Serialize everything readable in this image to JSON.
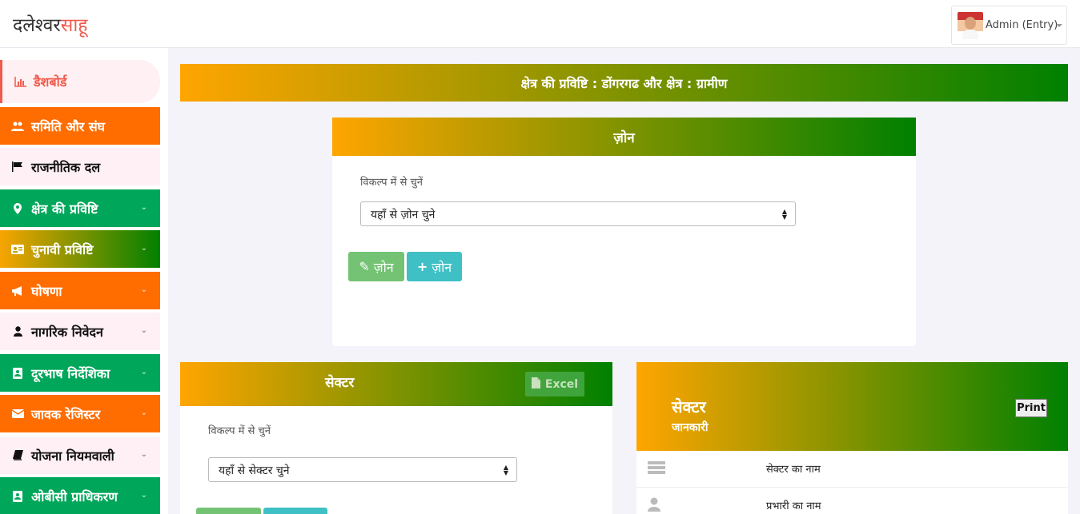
{
  "header": {
    "logo_main": "दलेश्वर",
    "logo_accent": "साहू",
    "user_label": "Admin (Entry)"
  },
  "sidebar": {
    "items": [
      {
        "label": "डैशबोर्ड",
        "icon": "bar-chart-icon"
      },
      {
        "label": "समिति और संघ",
        "icon": "users-icon"
      },
      {
        "label": "राजनीतिक दल",
        "icon": "flag-icon"
      },
      {
        "label": "क्षेत्र की प्रविष्टि",
        "icon": "map-marker-icon"
      },
      {
        "label": "चुनावी प्रविष्टि",
        "icon": "id-card-icon"
      },
      {
        "label": "घोषणा",
        "icon": "bullhorn-icon"
      },
      {
        "label": "नागरिक निवेदन",
        "icon": "user-icon"
      },
      {
        "label": "दूरभाष निर्देशिका",
        "icon": "address-book-icon"
      },
      {
        "label": "जावक रेजिस्टर",
        "icon": "envelope-icon"
      },
      {
        "label": "योजना नियमवाली",
        "icon": "book-icon"
      },
      {
        "label": "ओबीसी प्राधिकरण",
        "icon": "address-book-icon"
      }
    ]
  },
  "banner": {
    "title": "क्षेत्र की प्रविष्टि : डोंगरगढ और क्षेत्र : ग्रामीण"
  },
  "zone_card": {
    "title": "ज़ोन",
    "select_label": "विकल्प में से चुनें",
    "select_value": "यहाँ से ज़ोन चुने",
    "edit_button": "ज़ोन",
    "add_button": "ज़ोन"
  },
  "sector_card": {
    "title": "सेक्टर",
    "excel_button": "Excel",
    "select_label": "विकल्प में से चुनें",
    "select_value": "यहाँ से सेक्टर चुने"
  },
  "sector_info": {
    "title": "सेक्टर",
    "subtitle": "जानकारी",
    "print_button": "Print",
    "rows": [
      {
        "label": "सेक्टर का नाम",
        "icon": "list-icon"
      },
      {
        "label": "प्रभारी का नाम",
        "icon": "user-icon"
      }
    ]
  }
}
